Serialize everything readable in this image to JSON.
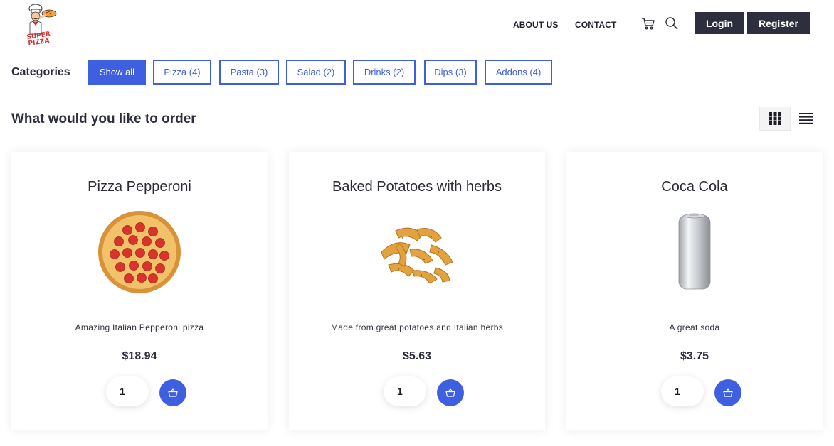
{
  "nav": {
    "about": "ABOUT US",
    "contact": "CONTACT",
    "login": "Login",
    "register": "Register"
  },
  "categories": {
    "title": "Categories",
    "items": [
      {
        "label": "Show all",
        "active": true
      },
      {
        "label": "Pizza (4)",
        "active": false
      },
      {
        "label": "Pasta (3)",
        "active": false
      },
      {
        "label": "Salad (2)",
        "active": false
      },
      {
        "label": "Drinks (2)",
        "active": false
      },
      {
        "label": "Dips (3)",
        "active": false
      },
      {
        "label": "Addons (4)",
        "active": false
      }
    ]
  },
  "section": {
    "title": "What would you like to order"
  },
  "products": [
    {
      "name": "Pizza Pepperoni",
      "description": "Amazing Italian Pepperoni pizza",
      "price": "$18.94",
      "quantity": "1",
      "image": "pepperoni-pizza"
    },
    {
      "name": "Baked Potatoes with herbs",
      "description": "Made from great potatoes and Italian herbs",
      "price": "$5.63",
      "quantity": "1",
      "image": "potato-wedges"
    },
    {
      "name": "Coca Cola",
      "description": "A great soda",
      "price": "$3.75",
      "quantity": "1",
      "image": "soda-can"
    }
  ],
  "colors": {
    "accent": "#3d5fe0",
    "dark_button": "#2e2f3e"
  }
}
